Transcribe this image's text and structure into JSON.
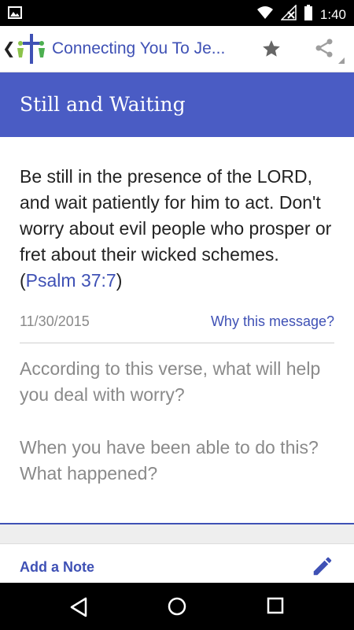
{
  "status_bar": {
    "time": "1:40",
    "icons": [
      "gallery-icon",
      "wifi-icon",
      "no-signal-icon",
      "battery-icon"
    ]
  },
  "app_bar": {
    "title": "Connecting You To Je...",
    "icons": [
      "back-chevron-icon",
      "app-logo-icon",
      "star-icon",
      "share-icon"
    ]
  },
  "message": {
    "title": "Still and Waiting",
    "verse_text": "Be still in the presence of the LORD, and wait patiently for him to act. Don't worry about evil people who prosper or fret about their wicked schemes. (",
    "reference": "Psalm 37:7",
    "verse_close": ")",
    "date": "11/30/2015",
    "why_link": "Why this message?"
  },
  "questions": [
    "According to this verse, what will help you deal with worry?",
    "When you have been able to do this? What happened?"
  ],
  "footer": {
    "add_note": "Add a Note",
    "icons": [
      "pencil-icon"
    ]
  },
  "nav_bar": {
    "icons": [
      "back-triangle-icon",
      "home-circle-icon",
      "recents-square-icon"
    ]
  },
  "colors": {
    "accent": "#3f51b5",
    "header_band": "#4a5cc4",
    "muted_text": "#8a8a8a"
  }
}
